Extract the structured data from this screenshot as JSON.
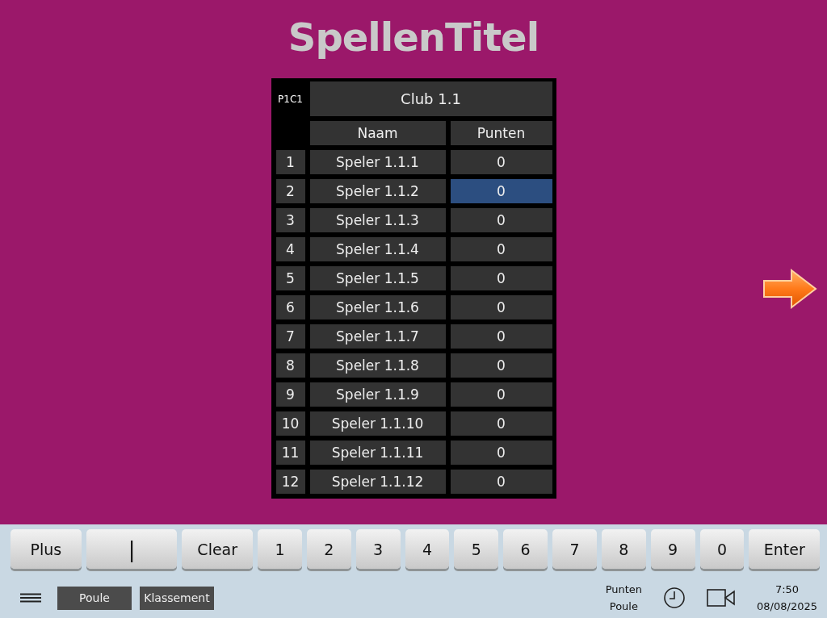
{
  "title": "SpellenTitel",
  "table": {
    "code": "P1C1",
    "club": "Club 1.1",
    "columns": [
      "Naam",
      "Punten"
    ],
    "rows": [
      {
        "number": "1",
        "name": "Speler 1.1.1",
        "points": "0",
        "selected": false
      },
      {
        "number": "2",
        "name": "Speler 1.1.2",
        "points": "0",
        "selected": true
      },
      {
        "number": "3",
        "name": "Speler 1.1.3",
        "points": "0",
        "selected": false
      },
      {
        "number": "4",
        "name": "Speler 1.1.4",
        "points": "0",
        "selected": false
      },
      {
        "number": "5",
        "name": "Speler 1.1.5",
        "points": "0",
        "selected": false
      },
      {
        "number": "6",
        "name": "Speler 1.1.6",
        "points": "0",
        "selected": false
      },
      {
        "number": "7",
        "name": "Speler 1.1.7",
        "points": "0",
        "selected": false
      },
      {
        "number": "8",
        "name": "Speler 1.1.8",
        "points": "0",
        "selected": false
      },
      {
        "number": "9",
        "name": "Speler 1.1.9",
        "points": "0",
        "selected": false
      },
      {
        "number": "10",
        "name": "Speler 1.1.10",
        "points": "0",
        "selected": false
      },
      {
        "number": "11",
        "name": "Speler 1.1.11",
        "points": "0",
        "selected": false
      },
      {
        "number": "12",
        "name": "Speler 1.1.12",
        "points": "0",
        "selected": false
      }
    ]
  },
  "keypad": [
    {
      "kind": "key",
      "label": "Plus"
    },
    {
      "kind": "input",
      "value": "|"
    },
    {
      "kind": "key",
      "label": "Clear"
    },
    {
      "kind": "digit",
      "label": "1"
    },
    {
      "kind": "digit",
      "label": "2"
    },
    {
      "kind": "digit",
      "label": "3"
    },
    {
      "kind": "digit",
      "label": "4"
    },
    {
      "kind": "digit",
      "label": "5"
    },
    {
      "kind": "digit",
      "label": "6"
    },
    {
      "kind": "digit",
      "label": "7"
    },
    {
      "kind": "digit",
      "label": "8"
    },
    {
      "kind": "digit",
      "label": "9"
    },
    {
      "kind": "digit",
      "label": "0"
    },
    {
      "kind": "key",
      "label": "Enter"
    }
  ],
  "tabs": [
    {
      "label": "Poule"
    },
    {
      "label": "Klassement"
    }
  ],
  "status": {
    "mode_lines": [
      "Punten",
      "Poule"
    ],
    "time": "7:50",
    "date": "08/08/2025"
  }
}
